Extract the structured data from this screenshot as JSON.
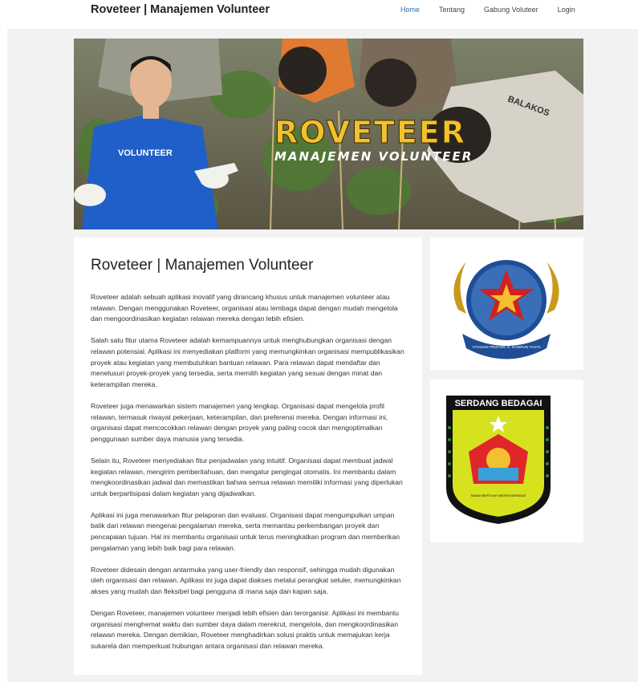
{
  "header": {
    "brand": "Roveteer | Manajemen Volunteer",
    "nav": [
      "Home",
      "Tentang",
      "Gabung Voluteer",
      "Login"
    ]
  },
  "hero": {
    "title": "ROVETEER",
    "subtitle": "MANAJEMEN VOLUNTEER",
    "shirt_text": "VOLUNTEER",
    "back_text": "BALAKOS"
  },
  "article": {
    "title": "Roveteer | Manajemen Volunteer",
    "paragraphs": [
      "Roveteer adalah sebuah aplikasi inovatif yang dirancang khusus untuk manajemen volunteer atau relawan. Dengan menggunakan Roveteer, organisasi atau lembaga dapat dengan mudah mengelola dan mengoordinasikan kegiatan relawan mereka dengan lebih efisien.",
      "Salah satu fitur utama Roveteer adalah kemampuannya untuk menghubungkan organisasi dengan relawan potensial. Aplikasi ini menyediakan platform yang memungkinkan organisasi mempublikasikan proyek atau kegiatan yang membutuhkan bantuan relawan. Para relawan dapat mendaftar dan menelusuri proyek-proyek yang tersedia, serta memilih kegiatan yang sesuai dengan minat dan keterampilan mereka.",
      "Roveteer juga menawarkan sistem manajemen yang lengkap. Organisasi dapat mengelola profil relawan, termasuk riwayat pekerjaan, keterampilan, dan preferensi mereka. Dengan informasi ini, organisasi dapat mencocokkan relawan dengan proyek yang paling cocok dan mengoptimalkan penggunaan sumber daya manusia yang tersedia.",
      "Selain itu, Roveteer menyediakan fitur penjadwalan yang intuitif. Organisasi dapat membuat jadwal kegiatan relawan, mengirim pemberitahuan, dan mengatur pengingat otomatis. Ini membantu dalam mengkoordinasikan jadwal dan memastikan bahwa semua relawan memiliki informasi yang diperlukan untuk berpartisipasi dalam kegiatan yang dijadwalkan.",
      "Aplikasi ini juga menawarkan fitur pelaporan dan evaluasi. Organisasi dapat mengumpulkan umpan balik dari relawan mengenai pengalaman mereka, serta memantau perkembangan proyek dan pencapaian tujuan. Hal ini membantu organisasi untuk terus meningkatkan program dan memberikan pengalaman yang lebih baik bagi para relawan.",
      "Roveteer didesain dengan antarmuka yang user-friendly dan responsif, sehingga mudah digunakan oleh organisasi dan relawan. Aplikasi ini juga dapat diakses melalui perangkat seluler, memungkinkan akses yang mudah dan fleksibel bagi pengguna di mana saja dan kapan saja.",
      "Dengan Roveteer, manajemen volunteer menjadi lebih efisien dan terorganisir. Aplikasi ini membantu organisasi menghemat waktu dan sumber daya dalam merekrut, mengelola, dan mengkoordinasikan relawan mereka. Dengan demikian, Roveteer menghadirkan solusi praktis untuk memajukan kerja sukarela dan memperkuat hubungan antara organisasi dan relawan mereka."
    ]
  },
  "sidebar": {
    "logo1_ribbon": "YAYASAN PROF.DR. H. KADIRUN YAHYA",
    "logo2_title": "SERDANG BEDAGAI",
    "logo2_motto": "TANAH BERTUAH NEGERI BERADAT"
  },
  "colors": {
    "active_nav": "#2a6db0",
    "hero_title": "#f2c12e",
    "page_bg": "#f2f2f2"
  }
}
